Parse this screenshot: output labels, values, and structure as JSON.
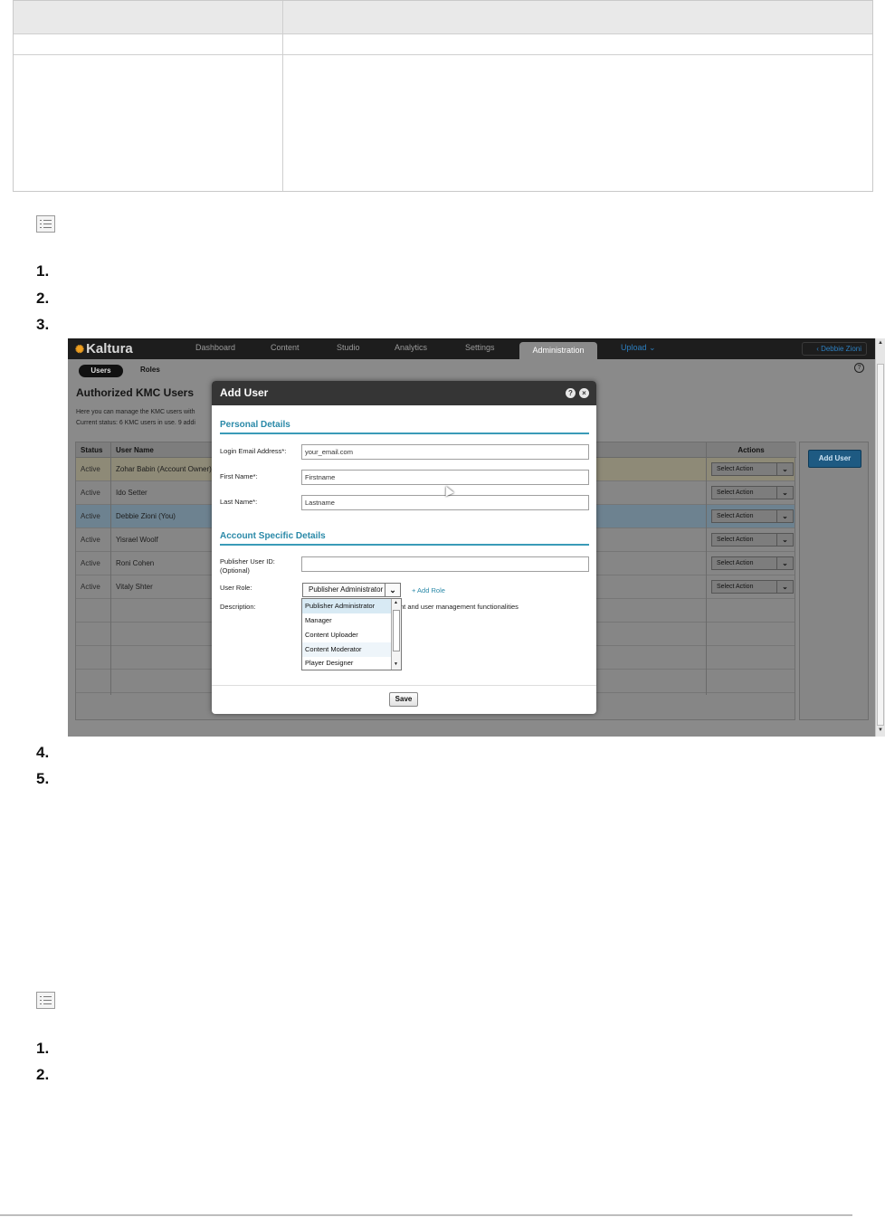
{
  "document": {
    "step_numbers_a": [
      "1.",
      "2.",
      "3.",
      "4.",
      "5."
    ],
    "step_numbers_b": [
      "1.",
      "2."
    ]
  },
  "kmc": {
    "logo": "Kaltura",
    "nav": [
      "Dashboard",
      "Content",
      "Studio",
      "Analytics",
      "Settings",
      "Administration",
      "Upload"
    ],
    "user": "Debbie Zioni",
    "subtabs": [
      "Users",
      "Roles"
    ],
    "page_title": "Authorized KMC Users",
    "desc_line1": "Here you can manage the KMC users with",
    "desc_line2": "Current status: 6 KMC users  in use. 9 addi",
    "columns": {
      "status": "Status",
      "name": "User Name",
      "actions": "Actions"
    },
    "rows": [
      {
        "status": "Active",
        "name": "Zohar Babin (Account Owner)",
        "action": "Select Action"
      },
      {
        "status": "Active",
        "name": "Ido Setter",
        "action": "Select Action"
      },
      {
        "status": "Active",
        "name": "Debbie Zioni (You)",
        "action": "Select Action"
      },
      {
        "status": "Active",
        "name": "Yisrael Woolf",
        "action": "Select Action"
      },
      {
        "status": "Active",
        "name": "Roni Cohen",
        "action": "Select Action"
      },
      {
        "status": "Active",
        "name": "Vitaly Shter",
        "action": "Select Action"
      }
    ],
    "add_user_button": "Add User",
    "help": "?"
  },
  "modal": {
    "title": "Add User",
    "personal_section": "Personal Details",
    "email_label": "Login Email Address*:",
    "email_value": "your_email.com",
    "first_label": "First Name*:",
    "first_value": "Firstname",
    "last_label": "Last Name*:",
    "last_value": "Lastname",
    "account_section": "Account Specific Details",
    "publisher_label": "Publisher User ID:",
    "publisher_optional": "(Optional)",
    "role_label": "User Role:",
    "role_value": "Publisher Administrator",
    "add_role": "+ Add Role",
    "description_label": "Description:",
    "description_text": "nt and user management functionalities",
    "role_options": [
      "Publisher Administrator",
      "Manager",
      "Content Uploader",
      "Content Moderator",
      "Player Designer"
    ],
    "save": "Save"
  },
  "colors": {
    "accent": "#2a89a8",
    "add_user_btn": "#1e5a82",
    "topbar": "#1d1d1d"
  }
}
